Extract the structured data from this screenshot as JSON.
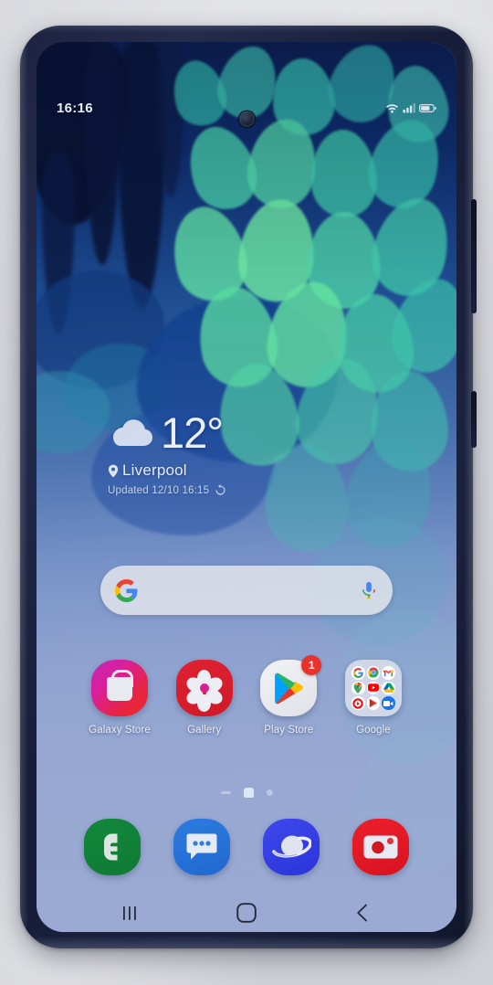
{
  "device": {
    "kind": "smartphone",
    "body_color": "#1d2340",
    "side_buttons": [
      "volume-rocker",
      "power-button"
    ]
  },
  "status_bar": {
    "time": "16:16",
    "icons": [
      "wifi-icon",
      "signal-icon",
      "battery-icon"
    ]
  },
  "weather_widget": {
    "icon": "cloud-icon",
    "temperature": "12°",
    "location_icon": "location-pin-icon",
    "location": "Liverpool",
    "updated": "Updated 12/10 16:15",
    "refresh_icon": "refresh-icon"
  },
  "search_bar": {
    "logo": "google-g-icon",
    "placeholder": "",
    "value": "",
    "mic_icon": "microphone-icon"
  },
  "app_grid": {
    "apps": [
      {
        "label": "Galaxy Store",
        "icon": "galaxy-store-icon",
        "badge": ""
      },
      {
        "label": "Gallery",
        "icon": "gallery-icon",
        "badge": ""
      },
      {
        "label": "Play Store",
        "icon": "play-store-icon",
        "badge": "1"
      },
      {
        "label": "Google",
        "icon": "google-folder-icon",
        "badge": ""
      }
    ],
    "folder_contents": [
      "google-icon",
      "chrome-icon",
      "gmail-icon",
      "maps-icon",
      "youtube-icon",
      "drive-icon",
      "youtube-music-icon",
      "play-movies-icon",
      "duo-icon"
    ]
  },
  "page_indicator": {
    "pages": [
      "apps-page",
      "home-page",
      "page-3"
    ],
    "active_index": 1
  },
  "dock": {
    "apps": [
      {
        "label": "Phone",
        "icon": "phone-icon"
      },
      {
        "label": "Messages",
        "icon": "messages-icon"
      },
      {
        "label": "Internet",
        "icon": "samsung-internet-icon"
      },
      {
        "label": "Camera",
        "icon": "camera-icon"
      }
    ]
  },
  "nav_bar": {
    "buttons": [
      {
        "name": "recents",
        "icon": "recents-icon"
      },
      {
        "name": "home",
        "icon": "home-icon"
      },
      {
        "name": "back",
        "icon": "back-icon"
      }
    ]
  },
  "colors": {
    "accent_green": "#13873c",
    "accent_blue": "#2d7ce0",
    "accent_red": "#ec1f2c",
    "badge_red": "#e8322c",
    "wallpaper_deep": "#0b1c4c",
    "wallpaper_light": "#9aaad3"
  }
}
